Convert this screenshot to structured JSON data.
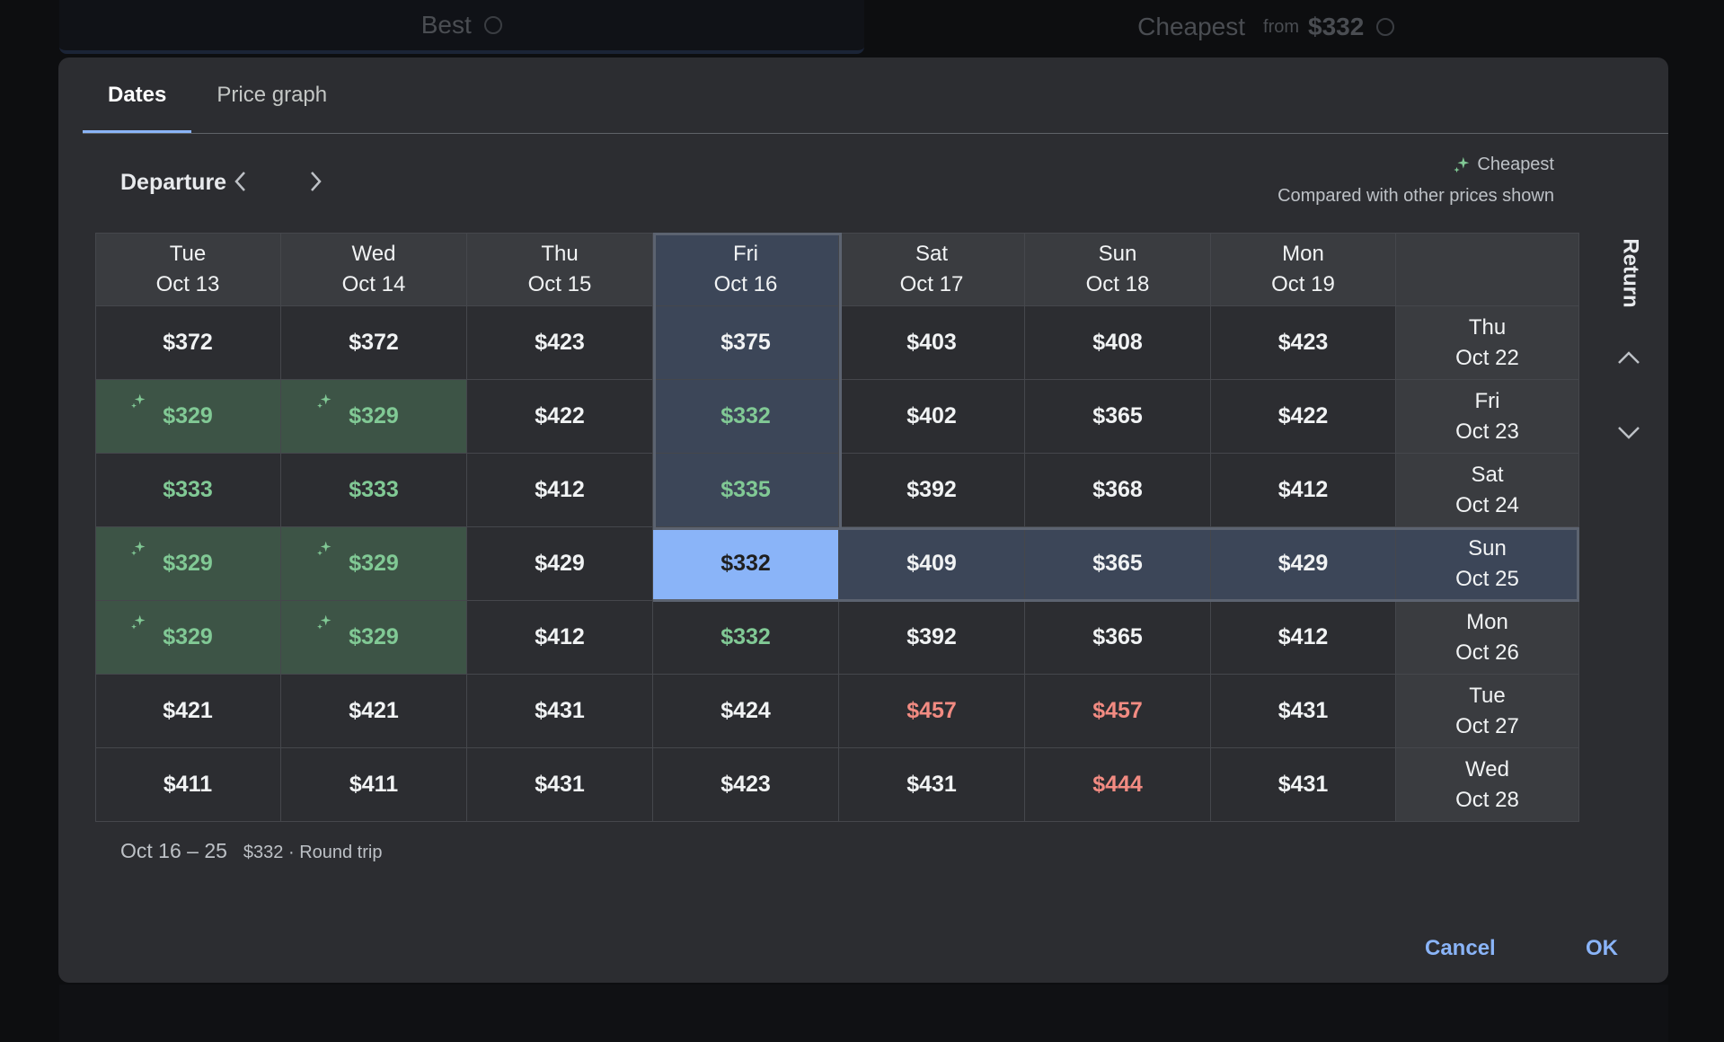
{
  "background": {
    "tabs": [
      {
        "label": "Best"
      },
      {
        "label": "Cheapest",
        "from": "from",
        "price": "$332"
      }
    ]
  },
  "tabs": [
    {
      "label": "Dates",
      "active": true
    },
    {
      "label": "Price graph",
      "active": false
    }
  ],
  "departure_label": "Departure",
  "legend": {
    "label": "Cheapest",
    "note": "Compared with other prices shown"
  },
  "return_label": "Return",
  "columns": [
    {
      "day": "Tue",
      "date": "Oct 13"
    },
    {
      "day": "Wed",
      "date": "Oct 14"
    },
    {
      "day": "Thu",
      "date": "Oct 15"
    },
    {
      "day": "Fri",
      "date": "Oct 16"
    },
    {
      "day": "Sat",
      "date": "Oct 17"
    },
    {
      "day": "Sun",
      "date": "Oct 18"
    },
    {
      "day": "Mon",
      "date": "Oct 19"
    }
  ],
  "rows": [
    {
      "day": "Thu",
      "date": "Oct 22",
      "prices": [
        "$372",
        "$372",
        "$423",
        "$375",
        "$403",
        "$408",
        "$423"
      ]
    },
    {
      "day": "Fri",
      "date": "Oct 23",
      "prices": [
        "$329",
        "$329",
        "$422",
        "$332",
        "$402",
        "$365",
        "$422"
      ]
    },
    {
      "day": "Sat",
      "date": "Oct 24",
      "prices": [
        "$333",
        "$333",
        "$412",
        "$335",
        "$392",
        "$368",
        "$412"
      ]
    },
    {
      "day": "Sun",
      "date": "Oct 25",
      "prices": [
        "$329",
        "$329",
        "$429",
        "$332",
        "$409",
        "$365",
        "$429"
      ]
    },
    {
      "day": "Mon",
      "date": "Oct 26",
      "prices": [
        "$329",
        "$329",
        "$412",
        "$332",
        "$392",
        "$365",
        "$412"
      ]
    },
    {
      "day": "Tue",
      "date": "Oct 27",
      "prices": [
        "$421",
        "$421",
        "$431",
        "$424",
        "$457",
        "$457",
        "$431"
      ]
    },
    {
      "day": "Wed",
      "date": "Oct 28",
      "prices": [
        "$411",
        "$411",
        "$431",
        "$423",
        "$431",
        "$444",
        "$431"
      ]
    }
  ],
  "summary": {
    "dates": "Oct 16 – 25",
    "detail": "$332 · Round trip"
  },
  "buttons": {
    "cancel": "Cancel",
    "ok": "OK"
  },
  "colors": {
    "accent": "#8ab4f8",
    "cheap_text": "#81c995",
    "expensive_text": "#f28b82",
    "cheapest_bg": "#3d5446"
  }
}
